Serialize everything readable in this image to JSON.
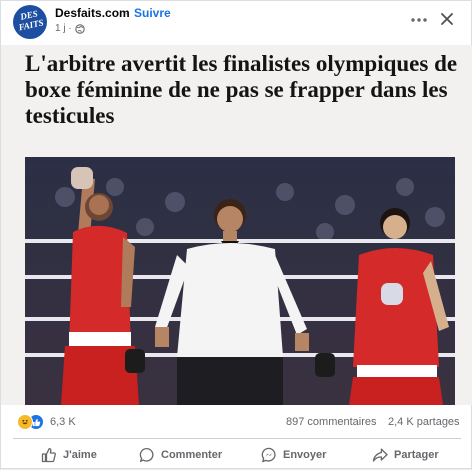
{
  "post": {
    "page_name": "Desfaits.com",
    "follow_separator": "·",
    "follow_label": "Suivre",
    "time": "1 j ·",
    "avatar_text": "DES FAITS",
    "headline": "L'arbitre avertit les finalistes olympiques de boxe féminine de ne pas se frapper dans les testicules"
  },
  "stats": {
    "reaction_count": "6,3 K",
    "comments": "897 commentaires",
    "shares": "2,4 K partages"
  },
  "actions": {
    "like": "J'aime",
    "comment": "Commenter",
    "send": "Envoyer",
    "share": "Partager"
  },
  "colors": {
    "accent": "#1b74e4",
    "muted": "#65676b",
    "avatar_bg": "#1e4ea1"
  }
}
